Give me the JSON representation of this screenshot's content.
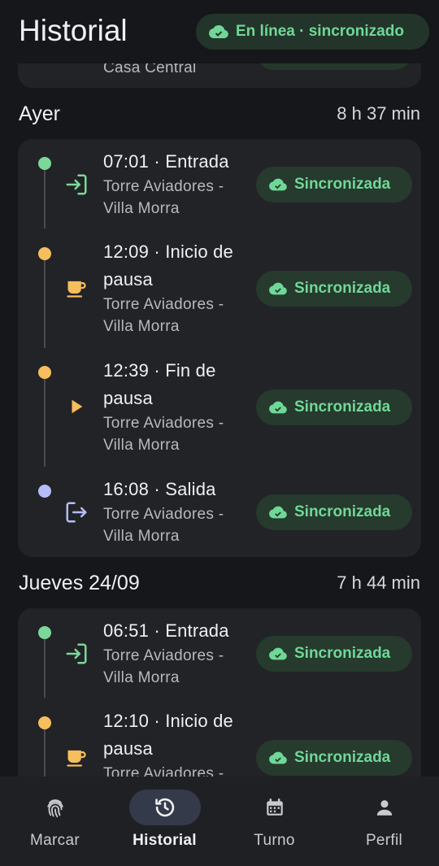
{
  "header": {
    "title": "Historial",
    "sync_status": "En línea · sincronizado"
  },
  "top_partial_location": "Casa Central",
  "days": [
    {
      "name": "Ayer",
      "total": "8 h 37 min",
      "entries": [
        {
          "time_label": "07:01 · Entrada",
          "location": "Torre Aviadores - Villa Morra",
          "status": "Sincronizada",
          "kind": "entrada"
        },
        {
          "time_label": "12:09 · Inicio de pausa",
          "location": "Torre Aviadores - Villa Morra",
          "status": "Sincronizada",
          "kind": "pausa"
        },
        {
          "time_label": "12:39 · Fin de pausa",
          "location": "Torre Aviadores - Villa Morra",
          "status": "Sincronizada",
          "kind": "fin-pausa"
        },
        {
          "time_label": "16:08 · Salida",
          "location": "Torre Aviadores - Villa Morra",
          "status": "Sincronizada",
          "kind": "salida"
        }
      ]
    },
    {
      "name": "Jueves 24/09",
      "total": "7 h 44 min",
      "entries": [
        {
          "time_label": "06:51 · Entrada",
          "location": "Torre Aviadores - Villa Morra",
          "status": "Sincronizada",
          "kind": "entrada"
        },
        {
          "time_label": "12:10 · Inicio de pausa",
          "location": "Torre Aviadores -",
          "status": "Sincronizada",
          "kind": "pausa"
        }
      ]
    }
  ],
  "colors": {
    "entrada": "#7bd89a",
    "pausa": "#f6be5c",
    "salida": "#b4bdf7",
    "accent_green": "#6fd896"
  },
  "nav": [
    {
      "label": "Marcar",
      "icon": "fingerprint-icon",
      "active": false
    },
    {
      "label": "Historial",
      "icon": "history-icon",
      "active": true
    },
    {
      "label": "Turno",
      "icon": "calendar-icon",
      "active": false
    },
    {
      "label": "Perfil",
      "icon": "person-icon",
      "active": false
    }
  ]
}
